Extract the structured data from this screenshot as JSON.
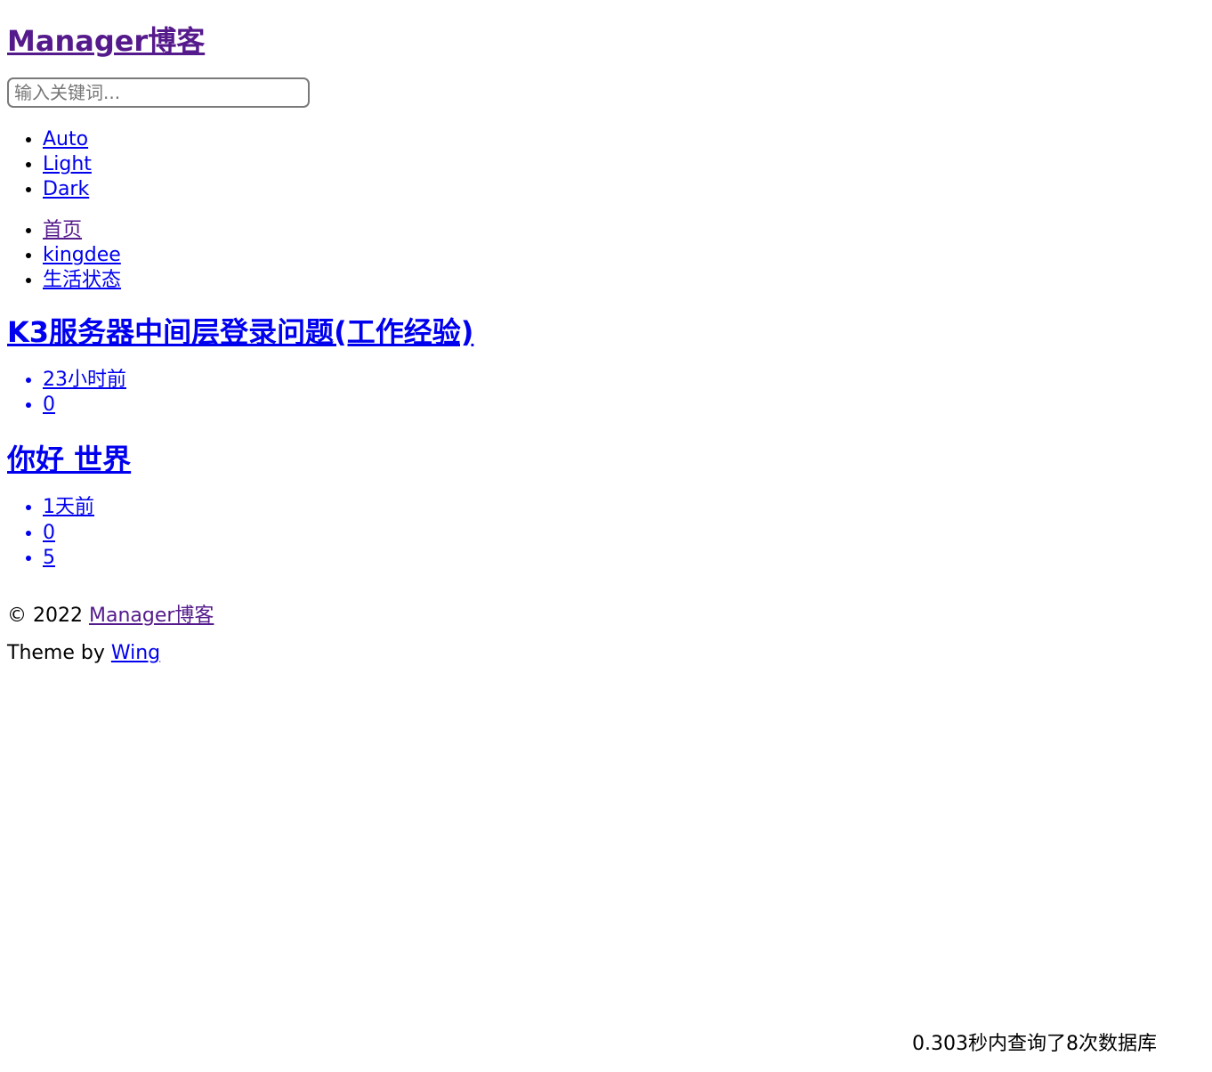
{
  "site": {
    "title": "Manager博客",
    "title_color": "#551A8B"
  },
  "search": {
    "placeholder": "输入关键词...",
    "value": ""
  },
  "theme_switcher": {
    "items": [
      {
        "label": "Auto",
        "state": "normal"
      },
      {
        "label": "Light",
        "state": "normal"
      },
      {
        "label": "Dark",
        "state": "normal"
      }
    ]
  },
  "main_nav": {
    "items": [
      {
        "label": "首页",
        "state": "visited"
      },
      {
        "label": "kingdee",
        "state": "normal"
      },
      {
        "label": "生活状态",
        "state": "normal"
      }
    ]
  },
  "articles": [
    {
      "title": "K3服务器中间层登录问题(工作经验)",
      "meta": [
        {
          "label": "23小时前",
          "kind": "date"
        },
        {
          "label": "0",
          "kind": "comments"
        }
      ]
    },
    {
      "title": "你好 世界",
      "meta": [
        {
          "label": "1天前",
          "kind": "date"
        },
        {
          "label": "0",
          "kind": "comments"
        },
        {
          "label": "5",
          "kind": "views"
        }
      ]
    }
  ],
  "footer": {
    "copyright_prefix": "© 2022 ",
    "site_link": "Manager博客",
    "theme_prefix": "Theme by ",
    "theme_link": "Wing"
  },
  "query_stats": {
    "text": "0.303秒内查询了8次数据库"
  },
  "colors": {
    "link": "#0000EE",
    "visited_link": "#551A8B",
    "text": "#000000",
    "input_border": "#7a7a7a",
    "placeholder": "#777777"
  }
}
